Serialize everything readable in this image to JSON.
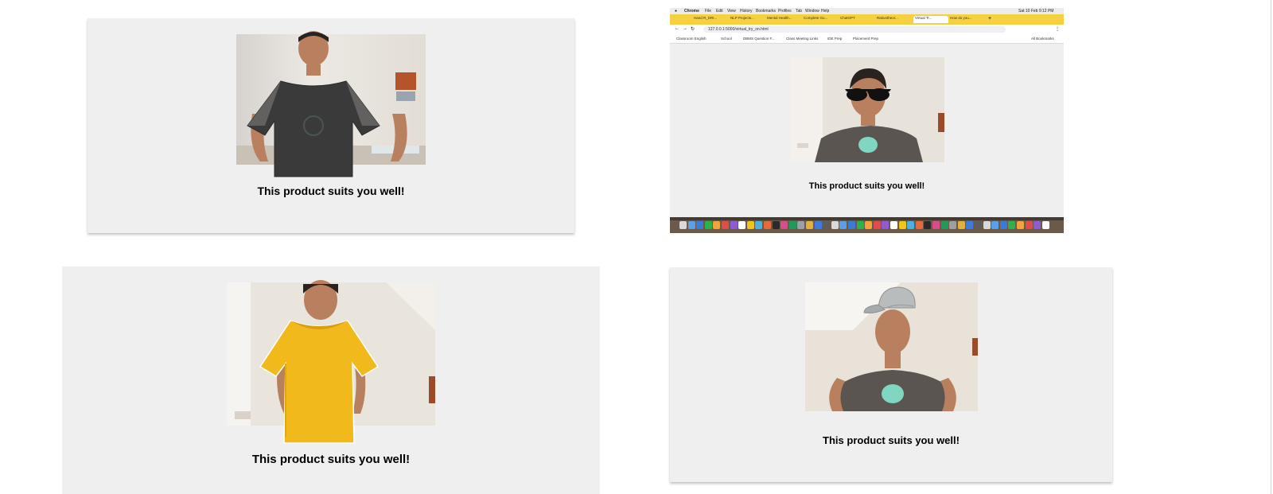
{
  "panels": [
    {
      "caption": "This product suits you well!",
      "overlay": "dark-t-shirt",
      "overlay_color": "#3a3a3a"
    },
    {
      "caption": "This product suits you well!",
      "overlay": "sunglasses",
      "overlay_color": "#111111"
    },
    {
      "caption": "This product suits you well!",
      "overlay": "yellow-t-shirt",
      "overlay_color": "#f2b91c"
    },
    {
      "caption": "This product suits you well!",
      "overlay": "grey-cap",
      "overlay_color": "#b9bcbd"
    }
  ],
  "browser": {
    "menu": [
      "Chrome",
      "File",
      "Edit",
      "View",
      "History",
      "Bookmarks",
      "Profiles",
      "Tab",
      "Window",
      "Help"
    ],
    "clock": "Sat 10 Feb 9:12 PM",
    "tabs": [
      "Hand R_DRI...",
      "NLP Projects...",
      "Mental Health...",
      "Complete Gu...",
      "ChatGPT",
      "Ratiuntheor...",
      "Virtual Tr...",
      "How do you..."
    ],
    "active_tab_index": 6,
    "url": "127.0.0.1:5000/virtual_try_on.html",
    "bookmarks": [
      "Classroom English",
      "School",
      "DBMS Question F...",
      "Class Meeting Links",
      "IDE Prep",
      "Placement Prep"
    ],
    "all_bookmarks": "All Bookmarks"
  },
  "colors": {
    "panel_bg": "#efefef",
    "tab_bar": "#f5d142",
    "skin": "#b8805e",
    "hair": "#2a221e",
    "tshirt_grey": "#5b5552",
    "dino_print": "#7fd6c1",
    "wall": "#e9e4dc"
  }
}
